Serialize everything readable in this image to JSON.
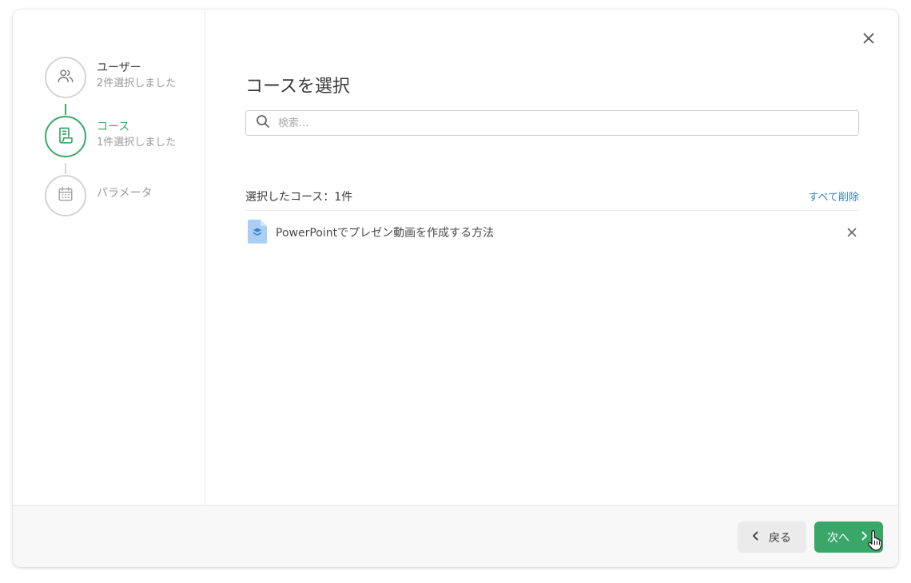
{
  "steps": [
    {
      "title": "ユーザー",
      "subtitle": "2件選択しました",
      "state": "done",
      "icon": "users-icon"
    },
    {
      "title": "コース",
      "subtitle": "1件選択しました",
      "state": "active",
      "icon": "course-document-icon"
    },
    {
      "title": "パラメータ",
      "subtitle": "",
      "state": "disabled",
      "icon": "calendar-icon"
    }
  ],
  "dialog": {
    "title": "コースを選択"
  },
  "search": {
    "placeholder": "検索...",
    "value": ""
  },
  "selected": {
    "label": "選択したコース：1件",
    "clear_all": "すべて削除",
    "items": [
      {
        "name": "PowerPointでプレゼン動画を作成する方法",
        "icon": "course-file-icon"
      }
    ]
  },
  "footer": {
    "back_label": "戻る",
    "next_label": "次へ"
  },
  "colors": {
    "accent": "#3aa769",
    "link": "#3b82c4",
    "border": "#d4d4d4",
    "file_icon": "#a9cff5"
  }
}
